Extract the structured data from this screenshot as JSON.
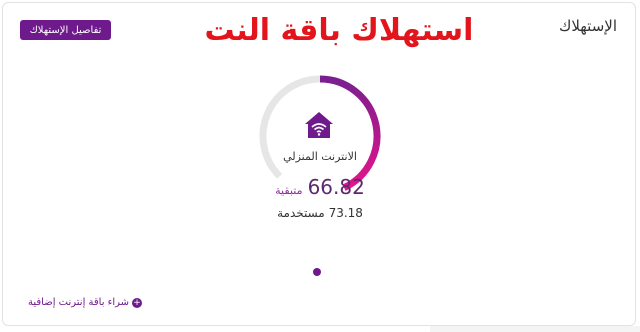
{
  "card": {
    "title": "الإستهلاك",
    "details_button": "تفاصيل الإستهلاك",
    "headline": "استهلاك باقة النت"
  },
  "gauge": {
    "label": "الانترنت المنزلي",
    "remaining_value": "66.82",
    "remaining_label": "متبقية",
    "used_text": "73.18 مستخدمة",
    "remaining_fraction": 0.477,
    "colors": {
      "track": "#e6e6e6",
      "start": "#7a1f8f",
      "end": "#e6148c"
    }
  },
  "footer": {
    "buy_link": "شراء باقة إنترنت إضافية"
  }
}
